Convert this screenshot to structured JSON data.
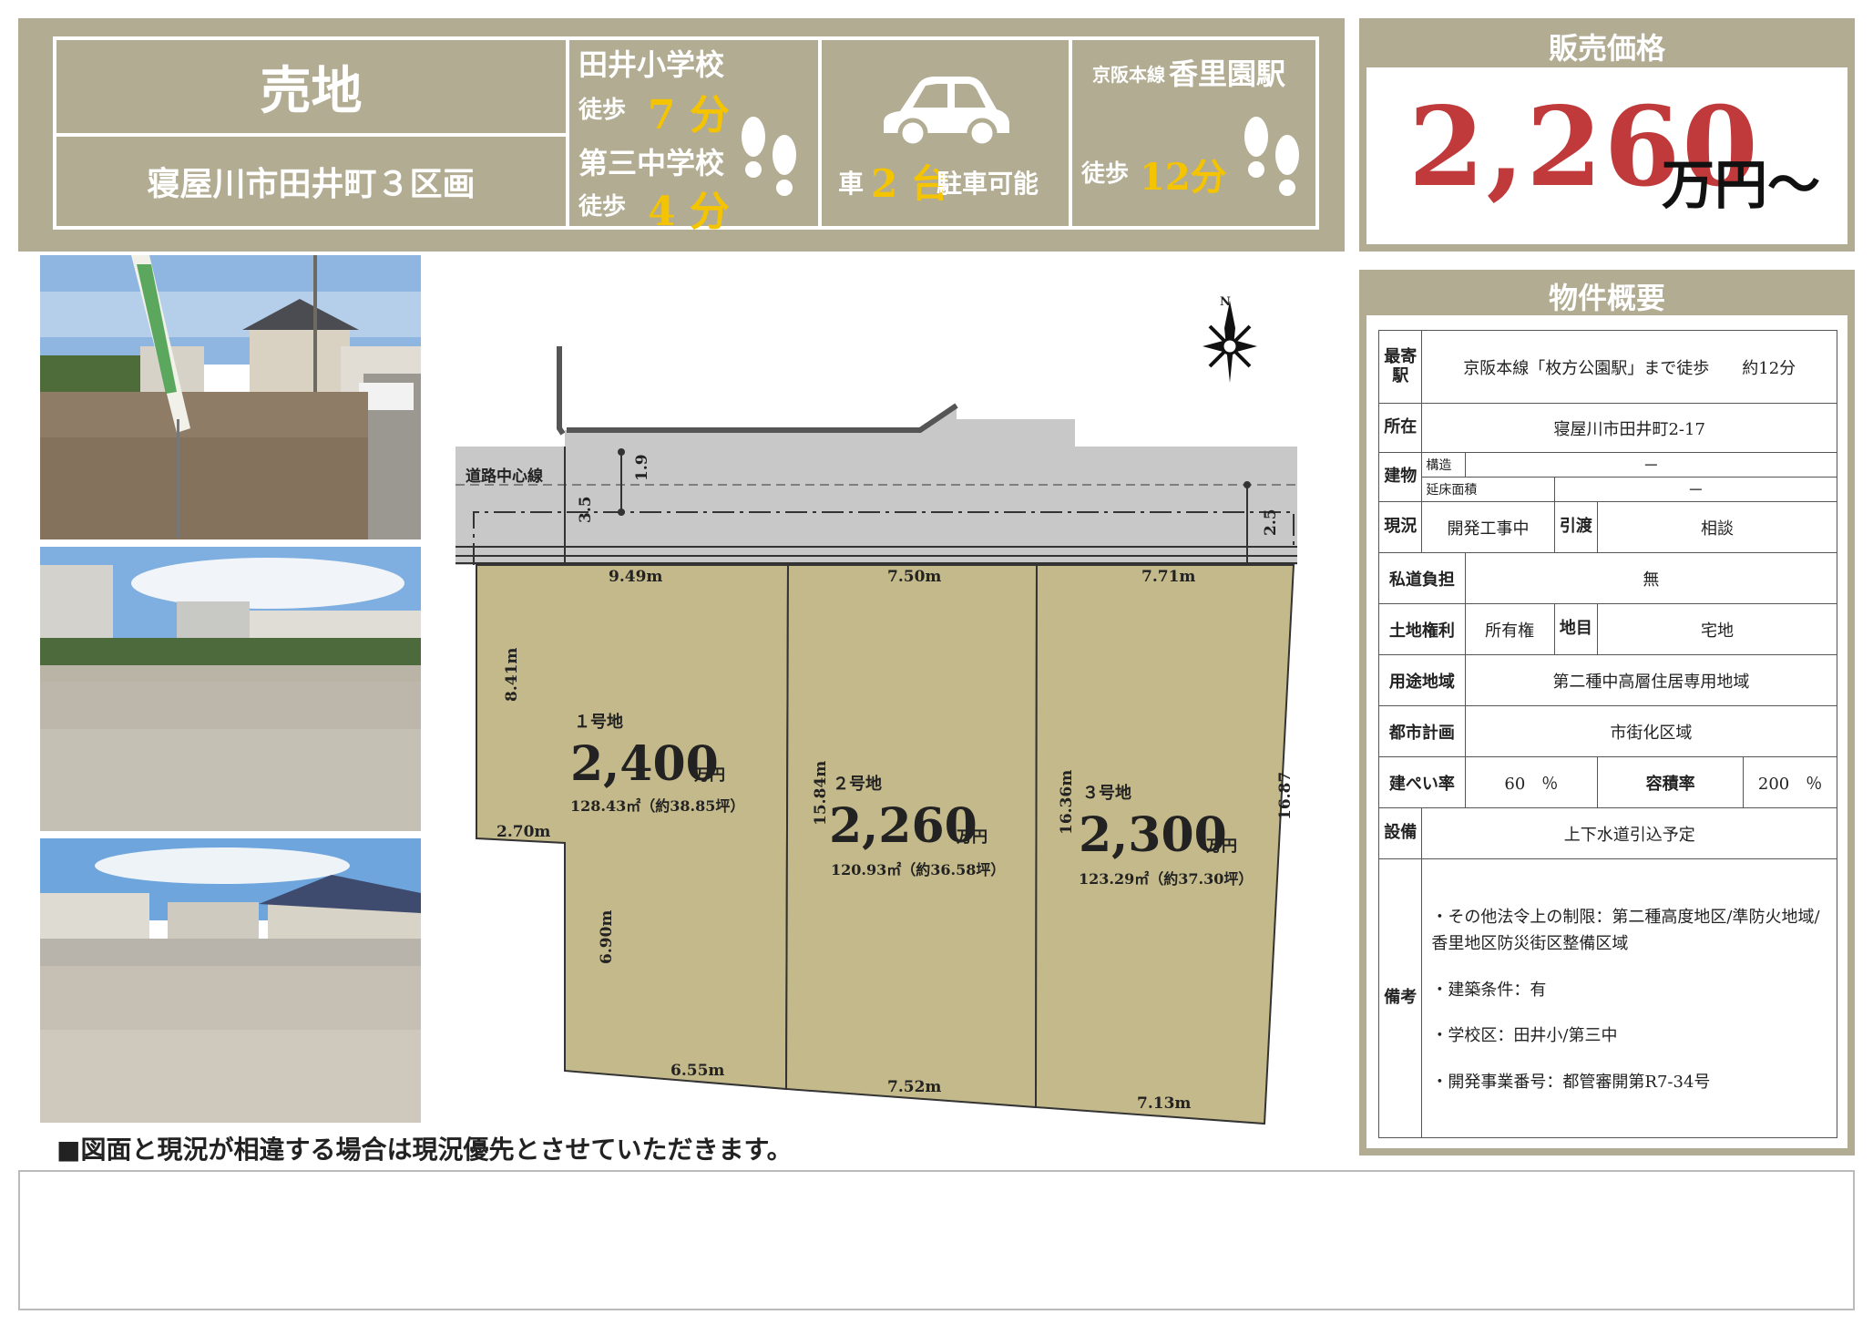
{
  "header": {
    "title": "売地",
    "address_title": "寝屋川市田井町３区画",
    "school1": "田井小学校",
    "school1_walk_label": "徒歩",
    "school1_walk_time": "7 分",
    "school2": "第三中学校",
    "school2_walk_label": "徒歩",
    "school2_walk_time": "4 分",
    "parking_prefix": "車",
    "parking_count": "2 台",
    "parking_suffix": "駐車可能",
    "station_line": "京阪本線",
    "station_name": "香里園駅",
    "station_walk_label": "徒歩",
    "station_walk_time": "12分"
  },
  "price": {
    "heading": "販売価格",
    "value": "2,260",
    "unit": "万円～"
  },
  "overview": {
    "heading": "物件概要",
    "nearest_station_label": "最寄駅",
    "nearest_station": "京阪本線「枚方公園駅」まで徒歩　　約12分",
    "location_label": "所在",
    "location": "寝屋川市田井町2-17",
    "building_label": "建物",
    "structure_label": "構造",
    "structure": "－",
    "floor_area_label": "延床面積",
    "floor_area": "－",
    "status_label": "現況",
    "status": "開発工事中",
    "delivery_label": "引渡",
    "delivery": "相談",
    "private_road_label": "私道負担",
    "private_road": "無",
    "land_right_label": "土地権利",
    "land_right": "所有権",
    "land_category_label": "地目",
    "land_category": "宅地",
    "zoning_label": "用途地域",
    "zoning": "第二種中高層住居専用地域",
    "city_plan_label": "都市計画",
    "city_plan": "市街化区域",
    "coverage_label": "建ぺい率",
    "coverage": "60　％",
    "far_label": "容積率",
    "far": "200　％",
    "facilities_label": "設備",
    "facilities": "上下水道引込予定",
    "remarks_label": "備考",
    "remarks": [
      "・その他法令上の制限：第二種高度地区/準防火地域/香里地区防災街区整備区域",
      "・建築条件：有",
      "・学校区：田井小/第三中",
      "・開発事業番号：都管審開第R7-34号"
    ]
  },
  "plan": {
    "road_label": "道路中心線",
    "north": "N",
    "dims": {
      "d_1_9": "1.9",
      "d_3_5": "3.5",
      "d_2_5": "2.5",
      "top1": "9.49m",
      "top2": "7.50m",
      "top3": "7.71m",
      "left_upper": "8.41m",
      "step": "2.70m",
      "left_lower": "6.90m",
      "bottom1": "6.55m",
      "bottom2": "7.52m",
      "bottom3": "7.13m",
      "side12": "15.84m",
      "side23": "16.36m",
      "right": "16.87"
    },
    "lots": [
      {
        "name": "１号地",
        "price": "2,400",
        "unit": "万円",
        "area": "128.43㎡（約38.85坪）"
      },
      {
        "name": "２号地",
        "price": "2,260",
        "unit": "万円",
        "area": "120.93㎡（約36.58坪）"
      },
      {
        "name": "３号地",
        "price": "2,300",
        "unit": "万円",
        "area": "123.29㎡（約37.30坪）"
      }
    ]
  },
  "photos": [
    "photo-site-with-flag",
    "photo-site-wide",
    "photo-site-houses"
  ],
  "notice": "■図面と現況が相違する場合は現況優先とさせていただきます。",
  "colors": {
    "olive": "#b2ac92",
    "lot_fill": "#c4b98a",
    "price_red": "#c0393b",
    "yellow": "#f5c400"
  }
}
